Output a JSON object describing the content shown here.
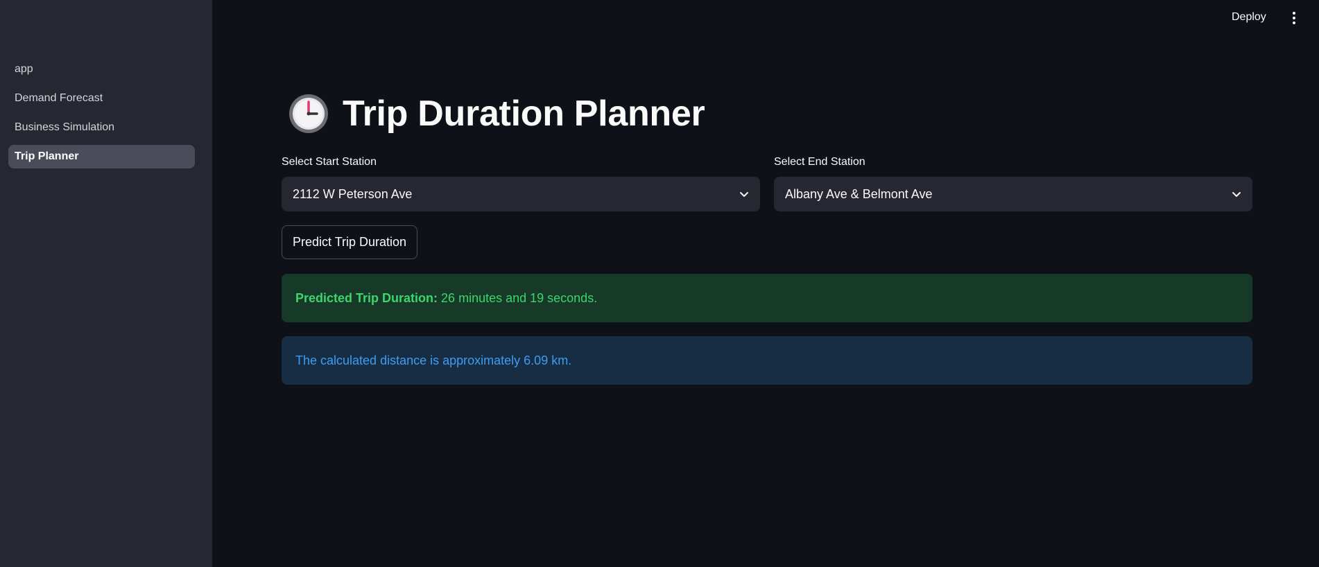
{
  "sidebar": {
    "items": [
      {
        "label": "app",
        "active": false
      },
      {
        "label": "Demand Forecast",
        "active": false
      },
      {
        "label": "Business Simulation",
        "active": false
      },
      {
        "label": "Trip Planner",
        "active": true
      }
    ]
  },
  "header": {
    "deploy_label": "Deploy",
    "menu_icon": "kebab-menu-icon"
  },
  "main": {
    "title_icon": "clock-icon",
    "title": "Trip Duration Planner",
    "start_station": {
      "label": "Select Start Station",
      "value": "2112 W Peterson Ave"
    },
    "end_station": {
      "label": "Select End Station",
      "value": "Albany Ave & Belmont Ave"
    },
    "predict_button": "Predict Trip Duration",
    "success": {
      "bold": "Predicted Trip Duration:",
      "text": "26 minutes and 19 seconds."
    },
    "info": "The calculated distance is approximately 6.09 km."
  },
  "colors": {
    "background": "#0e1117",
    "sidebar": "#262730",
    "success_bg": "#173928",
    "success_text": "#3dd56d",
    "info_bg": "#172d43",
    "info_text": "#3d9df3"
  }
}
